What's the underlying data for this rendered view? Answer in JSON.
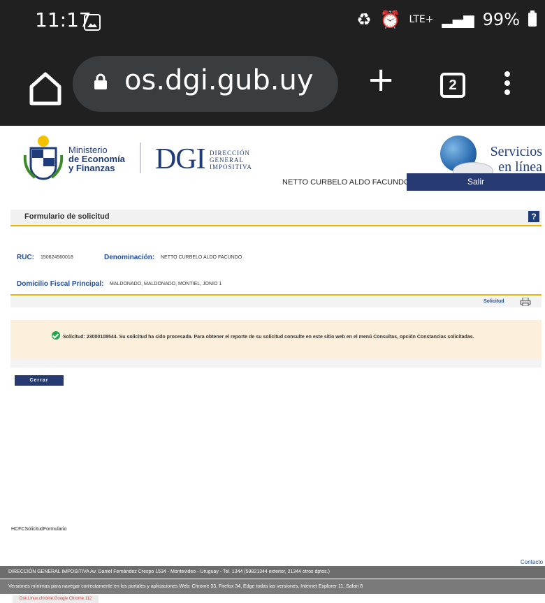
{
  "status_bar": {
    "time": "11:17",
    "network": "LTE+",
    "battery": "99%"
  },
  "browser": {
    "url": "os.dgi.gub.uy",
    "tab_count": "2"
  },
  "header": {
    "ministerio": [
      "Ministerio",
      "de Economía",
      "y Finanzas"
    ],
    "dgi": "DGI",
    "dgi_sub": [
      "DIRECCIÓN",
      "GENERAL",
      "IMPOSITIVA"
    ],
    "servicios": [
      "Servicios",
      "en línea"
    ]
  },
  "user": {
    "name": "NETTO CURBELO ALDO FACUNDO",
    "logout_label": "Salir"
  },
  "form": {
    "title": "Formulario de solicitud",
    "help": "?",
    "ruc_label": "RUC:",
    "ruc_value": "150624560018",
    "denominacion_label": "Denominación:",
    "denominacion_value": "NETTO CURBELO ALDO FACUNDO",
    "domicilio_label": "Domicilio Fiscal Principal:",
    "domicilio_value": "MALDONADO, MALDONADO, MONTIEL, JONIO 1",
    "solicitud_link": "Solicitud",
    "message": "Solicitud: 23000108544. Su solicitud ha sido procesada. Para obtener el reporte de su solicitud consulte en este sitio web en el menú Consultas, opción Constancias solicitadas.",
    "close_label": "Cerrar"
  },
  "footer": {
    "form_id": "HCFCSolicitudFormulario",
    "contacto": "Contacto",
    "line1": "DIRECCIÓN GENERAL IMPOSITIVA Av. Daniel Fernández Crespo 1534 - Montevideo - Uruguay - Tel. 1344 (59821344 exterior, 21344 otros dptos.)",
    "line2": "Versiones mínimas para navegar correctamente en los portales y aplicaciones Web: Chrome 33, Firefox 34, Edge todas las versiones, Internet Explorer 11, Safari 8",
    "build": "Dsk.Linux.chrome.Google Chrome.112"
  }
}
